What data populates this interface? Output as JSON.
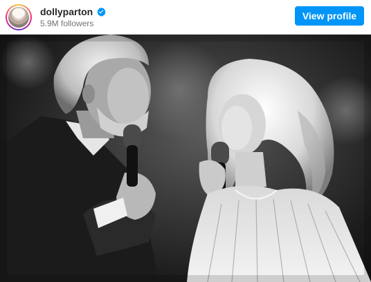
{
  "post_header": {
    "username": "dollyparton",
    "verified_icon": "verified-badge-icon",
    "followers": "5.9M followers",
    "view_profile_label": "View profile",
    "accent_color": "#0095f6"
  },
  "photo": {
    "alt_style": "black-and-white"
  }
}
